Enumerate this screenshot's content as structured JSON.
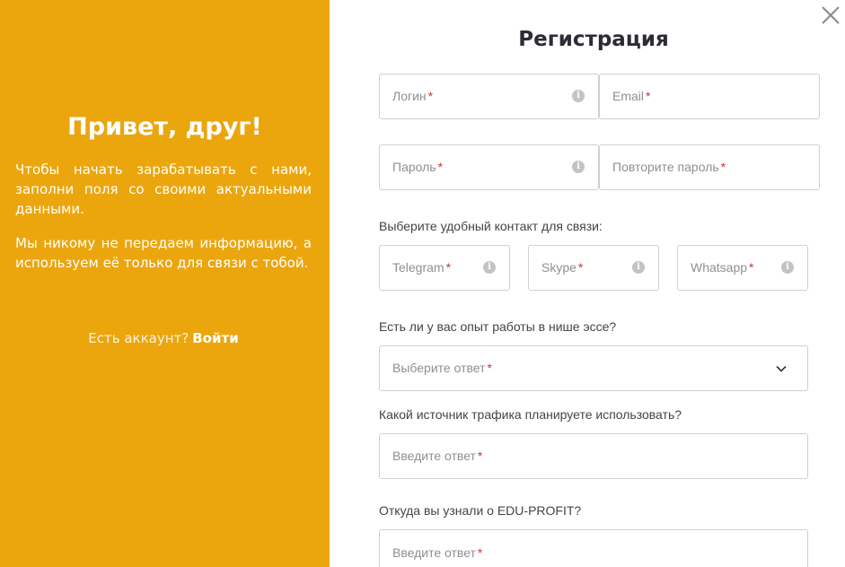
{
  "promo": {
    "title": "Привет, друг!",
    "paragraph1": "Чтобы начать зарабатывать с нами, заполни поля со своими актуальными данными.",
    "paragraph2": "Мы никому не передаем информацию, а используем её только для связи с тобой.",
    "have_account": "Есть аккаунт?",
    "login_link": "Войти"
  },
  "form": {
    "title": "Регистрация",
    "required_mark": "*",
    "login_placeholder": "Логин",
    "email_placeholder": "Email",
    "password_placeholder": "Пароль",
    "password_repeat_placeholder": "Повторите пароль",
    "contact_label": "Выберите удобный контакт для связи:",
    "telegram_placeholder": "Telegram",
    "skype_placeholder": "Skype",
    "whatsapp_placeholder": "Whatsapp",
    "experience_label": "Есть ли у вас опыт работы в нише эссе?",
    "experience_select": "Выберите ответ",
    "traffic_label": "Какой источник трафика планируете использовать?",
    "traffic_placeholder": "Введите ответ",
    "source_label": "Откуда вы узнали о EDU-PROFIT?",
    "source_placeholder": "Введите ответ"
  },
  "icons": {
    "info": "info-icon",
    "close": "close-icon",
    "chevron": "chevron-down-icon"
  },
  "colors": {
    "accent": "#eba60e",
    "required": "#d0342c",
    "border": "#cfcfcf"
  }
}
